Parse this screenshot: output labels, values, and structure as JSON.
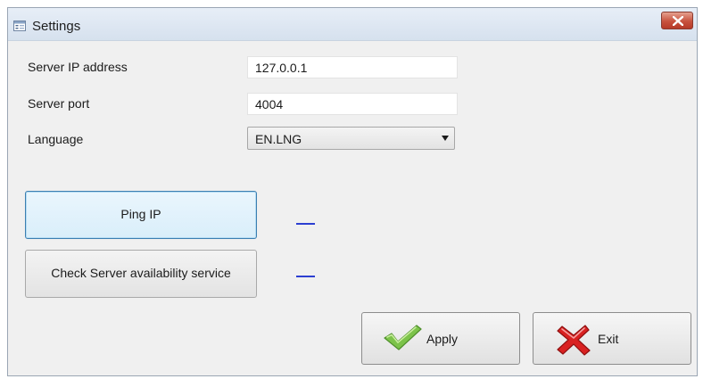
{
  "window": {
    "title": "Settings",
    "title_icon": "settings-window-icon",
    "close_icon": "close-icon"
  },
  "form": {
    "server_ip": {
      "label": "Server IP address",
      "value": "127.0.0.1"
    },
    "server_port": {
      "label": "Server port",
      "value": "4004"
    },
    "language": {
      "label": "Language",
      "value": "EN.LNG"
    }
  },
  "actions": {
    "ping_label": "Ping IP",
    "check_label": "Check Server availability service",
    "ping_status": "—",
    "check_status": "—"
  },
  "footer": {
    "apply_label": "Apply",
    "apply_icon": "checkmark-icon",
    "exit_label": "Exit",
    "exit_icon": "red-x-icon"
  },
  "colors": {
    "status_line": "#2c3fd1",
    "check_green": "#7cc34a",
    "exit_red": "#d92121"
  }
}
